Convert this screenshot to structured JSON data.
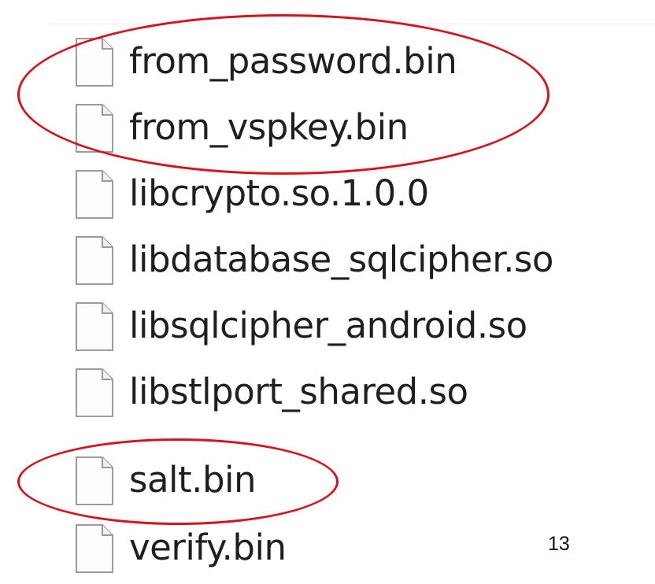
{
  "window": {
    "files": [
      {
        "name": "from_password.bin",
        "icon": "blank-file-icon"
      },
      {
        "name": "from_vspkey.bin",
        "icon": "blank-file-icon"
      },
      {
        "name": "libcrypto.so.1.0.0",
        "icon": "blank-file-icon"
      },
      {
        "name": "libdatabase_sqlcipher.so",
        "icon": "blank-file-icon"
      },
      {
        "name": "libsqlcipher_android.so",
        "icon": "blank-file-icon"
      },
      {
        "name": "libstlport_shared.so",
        "icon": "blank-file-icon"
      },
      {
        "name": "salt.bin",
        "icon": "blank-file-icon"
      },
      {
        "name": "verify.bin",
        "icon": "blank-file-icon"
      }
    ],
    "page_number": "13",
    "highlight_color": "#d8121b"
  }
}
